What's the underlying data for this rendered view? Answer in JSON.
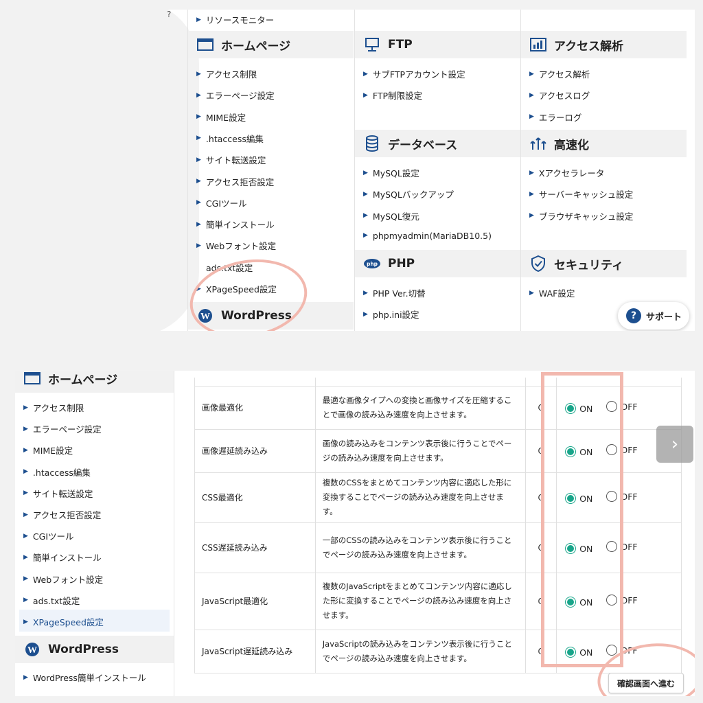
{
  "top": {
    "corner_glyph": "?",
    "resource_monitor": "リソースモニター",
    "homepage": {
      "title": "ホームページ",
      "items": [
        "アクセス制限",
        "エラーページ設定",
        "MIME設定",
        ".htaccess編集",
        "サイト転送設定",
        "アクセス拒否設定",
        "CGIツール",
        "簡単インストール",
        "Webフォント設定",
        "ads.txt設定",
        "XPageSpeed設定"
      ]
    },
    "wordpress": {
      "title": "WordPress"
    },
    "ftp": {
      "title": "FTP",
      "items": [
        "サブFTPアカウント設定",
        "FTP制限設定"
      ]
    },
    "database": {
      "title": "データベース",
      "items": [
        "MySQL設定",
        "MySQLバックアップ",
        "MySQL復元",
        "phpmyadmin(MariaDB10.5)"
      ]
    },
    "php": {
      "title": "PHP",
      "items": [
        "PHP Ver.切替",
        "php.ini設定"
      ]
    },
    "access": {
      "title": "アクセス解析",
      "items": [
        "アクセス解析",
        "アクセスログ",
        "エラーログ"
      ]
    },
    "speed": {
      "title": "高速化",
      "items": [
        "Xアクセラレータ",
        "サーバーキャッシュ設定",
        "ブラウザキャッシュ設定"
      ]
    },
    "security": {
      "title": "セキュリティ",
      "items": [
        "WAF設定"
      ]
    },
    "support": {
      "label": "サポート",
      "icon": "?"
    }
  },
  "bottom": {
    "sidebar": {
      "title": "ホームページ",
      "items": [
        "アクセス制限",
        "エラーページ設定",
        "MIME設定",
        ".htaccess編集",
        "サイト転送設定",
        "アクセス拒否設定",
        "CGIツール",
        "簡単インストール",
        "Webフォント設定",
        "ads.txt設定",
        "XPageSpeed設定"
      ],
      "active_item": "XPageSpeed設定",
      "wordpress_title": "WordPress",
      "wordpress_items": [
        "WordPress簡単インストール"
      ]
    },
    "rows": [
      {
        "name": "画像最適化",
        "desc": "最適な画像タイプへの変換と画像サイズを圧縮することで画像の読み込み速度を向上させます。",
        "current": "O",
        "on": "ON",
        "off": "OFF",
        "selected": "ON"
      },
      {
        "name": "画像遅延読み込み",
        "desc": "画像の読み込みをコンテンツ表示後に行うことでページの読み込み速度を向上させます。",
        "current": "O",
        "on": "ON",
        "off": "OFF",
        "selected": "ON"
      },
      {
        "name": "CSS最適化",
        "desc": "複数のCSSをまとめてコンテンツ内容に適応した形に変換することでページの読み込み速度を向上させます。",
        "current": "O",
        "on": "ON",
        "off": "OFF",
        "selected": "ON"
      },
      {
        "name": "CSS遅延読み込み",
        "desc": "一部のCSSの読み込みをコンテンツ表示後に行うことでページの読み込み速度を向上させます。",
        "current": "O",
        "on": "ON",
        "off": "OFF",
        "selected": "ON"
      },
      {
        "name": "JavaScript最適化",
        "desc": "複数のJavaScriptをまとめてコンテンツ内容に適応した形に変換することでページの読み込み速度を向上させます。",
        "current": "O",
        "on": "ON",
        "off": "OFF",
        "selected": "ON"
      },
      {
        "name": "JavaScript遅延読み込み",
        "desc": "JavaScriptの読み込みをコンテンツ表示後に行うことでページの読み込み速度を向上させます。",
        "current": "O",
        "on": "ON",
        "off": "OFF",
        "selected": "ON"
      }
    ],
    "confirm_label": "確認画面へ進む",
    "next_arrow": "›"
  },
  "colors": {
    "accent": "#1d4f8f",
    "radio_on": "#18a58a",
    "highlight": "#f2b8ae",
    "header_bg": "#f1f1f1"
  },
  "icons": {
    "homepage": "window-icon",
    "ftp": "monitor-icon",
    "database": "database-icon",
    "php": "php-icon",
    "access": "bar-chart-icon",
    "speed": "speed-arrows-icon",
    "security": "shield-check-icon",
    "wordpress": "wordpress-icon"
  }
}
